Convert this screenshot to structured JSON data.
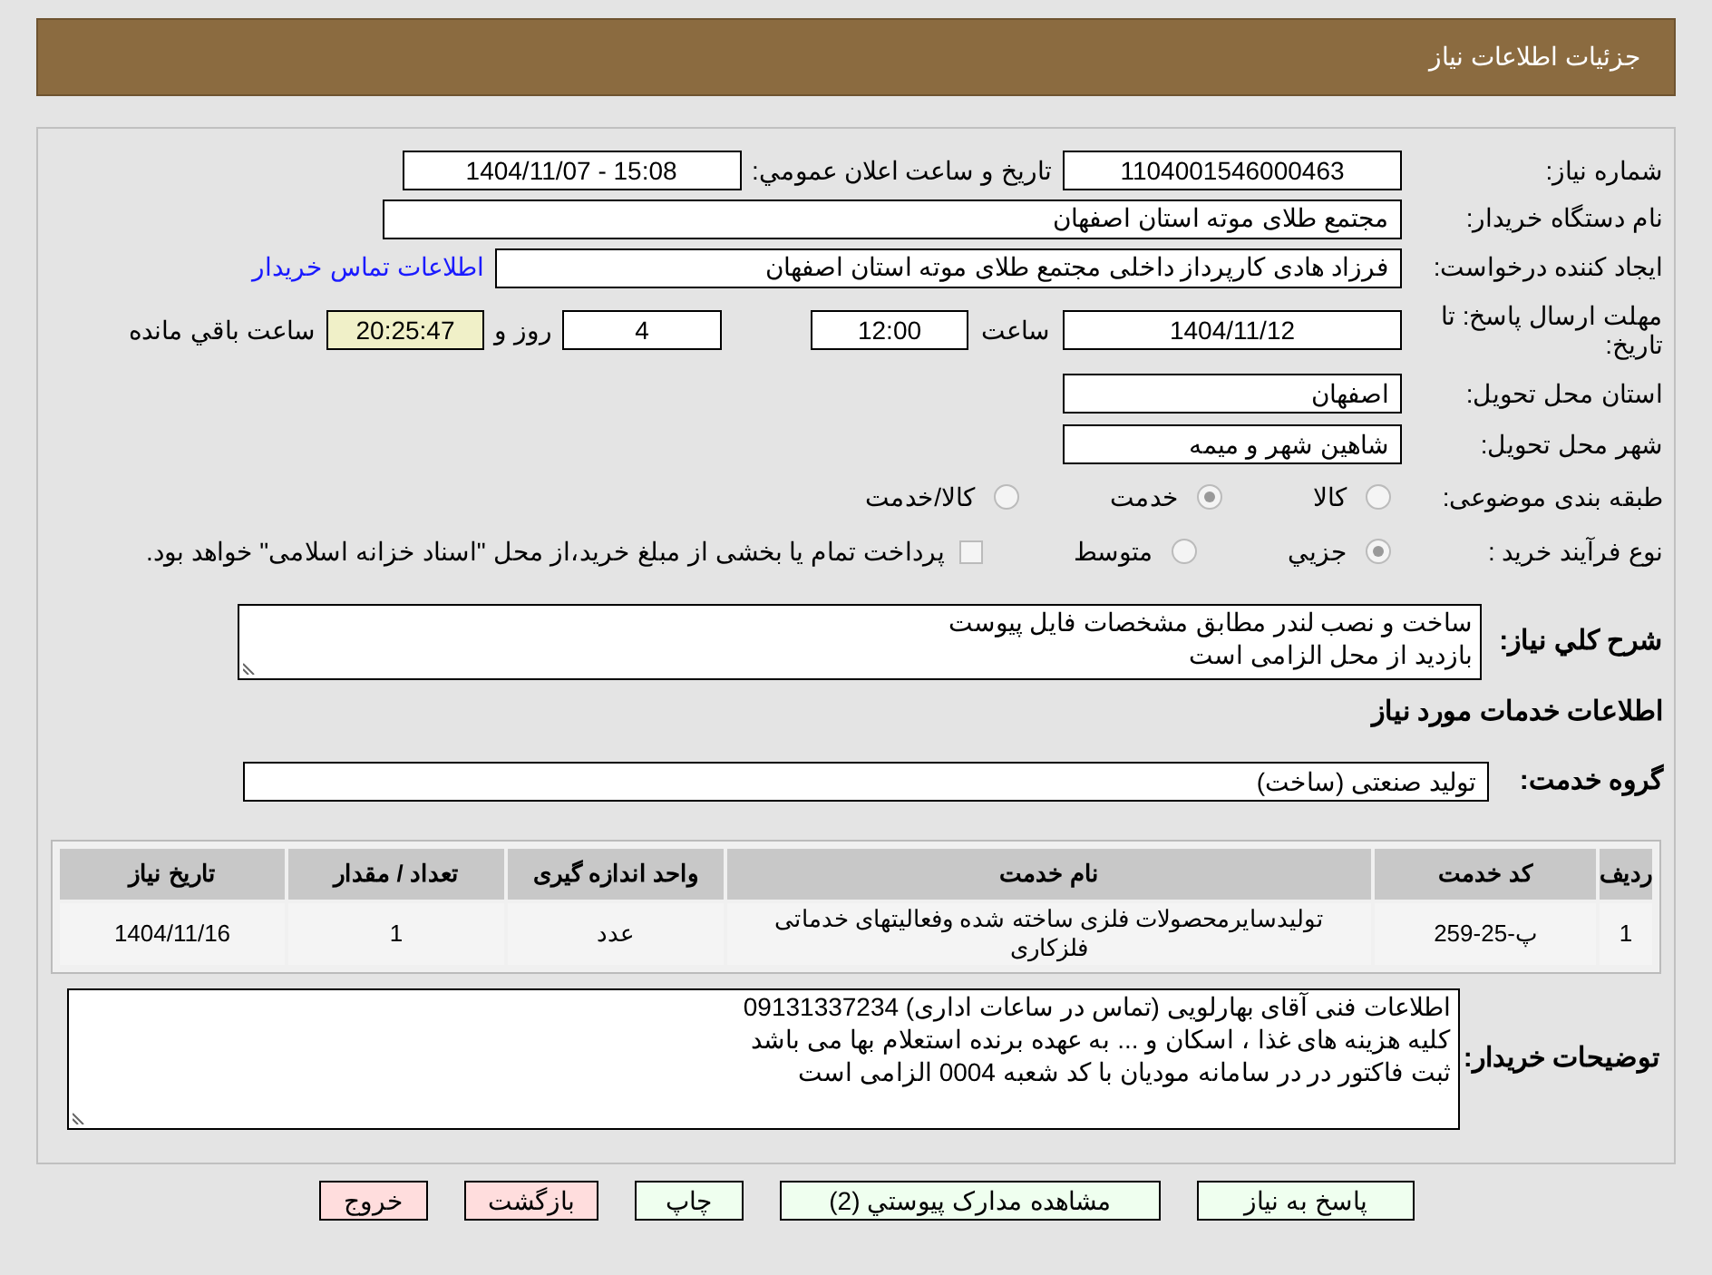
{
  "header": {
    "title": "جزئیات اطلاعات نیاز"
  },
  "need_number": {
    "label": "شماره نیاز:",
    "value": "1104001546000463"
  },
  "announce_date": {
    "label": "تاریخ و ساعت اعلان عمومي:",
    "value": "1404/11/07 - 15:08"
  },
  "buyer_org": {
    "label": "نام دستگاه خریدار:",
    "value": "مجتمع طلای موته استان اصفهان"
  },
  "requester": {
    "label": "ایجاد کننده درخواست:",
    "value": "فرزاد هادی کارپرداز داخلی مجتمع طلای موته استان اصفهان",
    "link": "اطلاعات تماس خریدار"
  },
  "deadline": {
    "label": "مهلت ارسال پاسخ: تا تاریخ:",
    "date": "1404/11/12",
    "time_label": "ساعت",
    "time": "12:00",
    "days": "4",
    "days_label": "روز و",
    "remaining": "20:25:47",
    "remaining_label": "ساعت باقي مانده"
  },
  "province": {
    "label": "استان محل تحویل:",
    "value": "اصفهان"
  },
  "city": {
    "label": "شهر محل تحویل:",
    "value": "شاهین شهر و میمه"
  },
  "category": {
    "label": "طبقه بندی موضوعی:",
    "options": [
      {
        "label": "کالا",
        "selected": false
      },
      {
        "label": "خدمت",
        "selected": true
      },
      {
        "label": "کالا/خدمت",
        "selected": false
      }
    ]
  },
  "process": {
    "label": "نوع فرآیند خرید :",
    "options": [
      {
        "label": "جزيي",
        "selected": true
      },
      {
        "label": "متوسط",
        "selected": false
      }
    ],
    "payment_note": {
      "checked": false,
      "text": "پرداخت تمام یا بخشی از مبلغ خرید،از محل \"اسناد خزانه اسلامی\" خواهد بود."
    }
  },
  "description": {
    "label": "شرح کلي نیاز:",
    "lines": [
      "ساخت و نصب لندر مطابق مشخصات فایل پیوست",
      "بازدید از محل الزامی است"
    ]
  },
  "services_heading": "اطلاعات خدمات مورد نیاز",
  "service_group": {
    "label": "گروه خدمت:",
    "value": "تولید صنعتی (ساخت)"
  },
  "table": {
    "columns": [
      "ردیف",
      "کد خدمت",
      "نام خدمت",
      "واحد اندازه گیری",
      "تعداد / مقدار",
      "تاریخ نیاز"
    ],
    "rows": [
      [
        "1",
        "پ-25-259",
        "تولیدسایرمحصولات فلزی ساخته شده وفعالیتهای خدماتی فلزکاری",
        "عدد",
        "1",
        "1404/11/16"
      ]
    ]
  },
  "buyer_notes": {
    "label": "توضیحات خریدار:",
    "lines": [
      "اطلاعات فنی آقای بهارلویی (تماس در ساعات اداری) 09131337234",
      "کلیه هزینه های غذا ، اسکان و ... به عهده برنده استعلام بها می باشد",
      "ثبت فاکتور در در سامانه مودیان با کد شعبه 0004 الزامی است"
    ]
  },
  "buttons": [
    {
      "label": "پاسخ به نیاز",
      "kind": "primary"
    },
    {
      "label": "مشاهده مدارک پیوستي (2)",
      "kind": "primary"
    },
    {
      "label": "چاپ",
      "kind": "primary"
    },
    {
      "label": "بازگشت",
      "kind": "danger"
    },
    {
      "label": "خروج",
      "kind": "danger"
    }
  ]
}
